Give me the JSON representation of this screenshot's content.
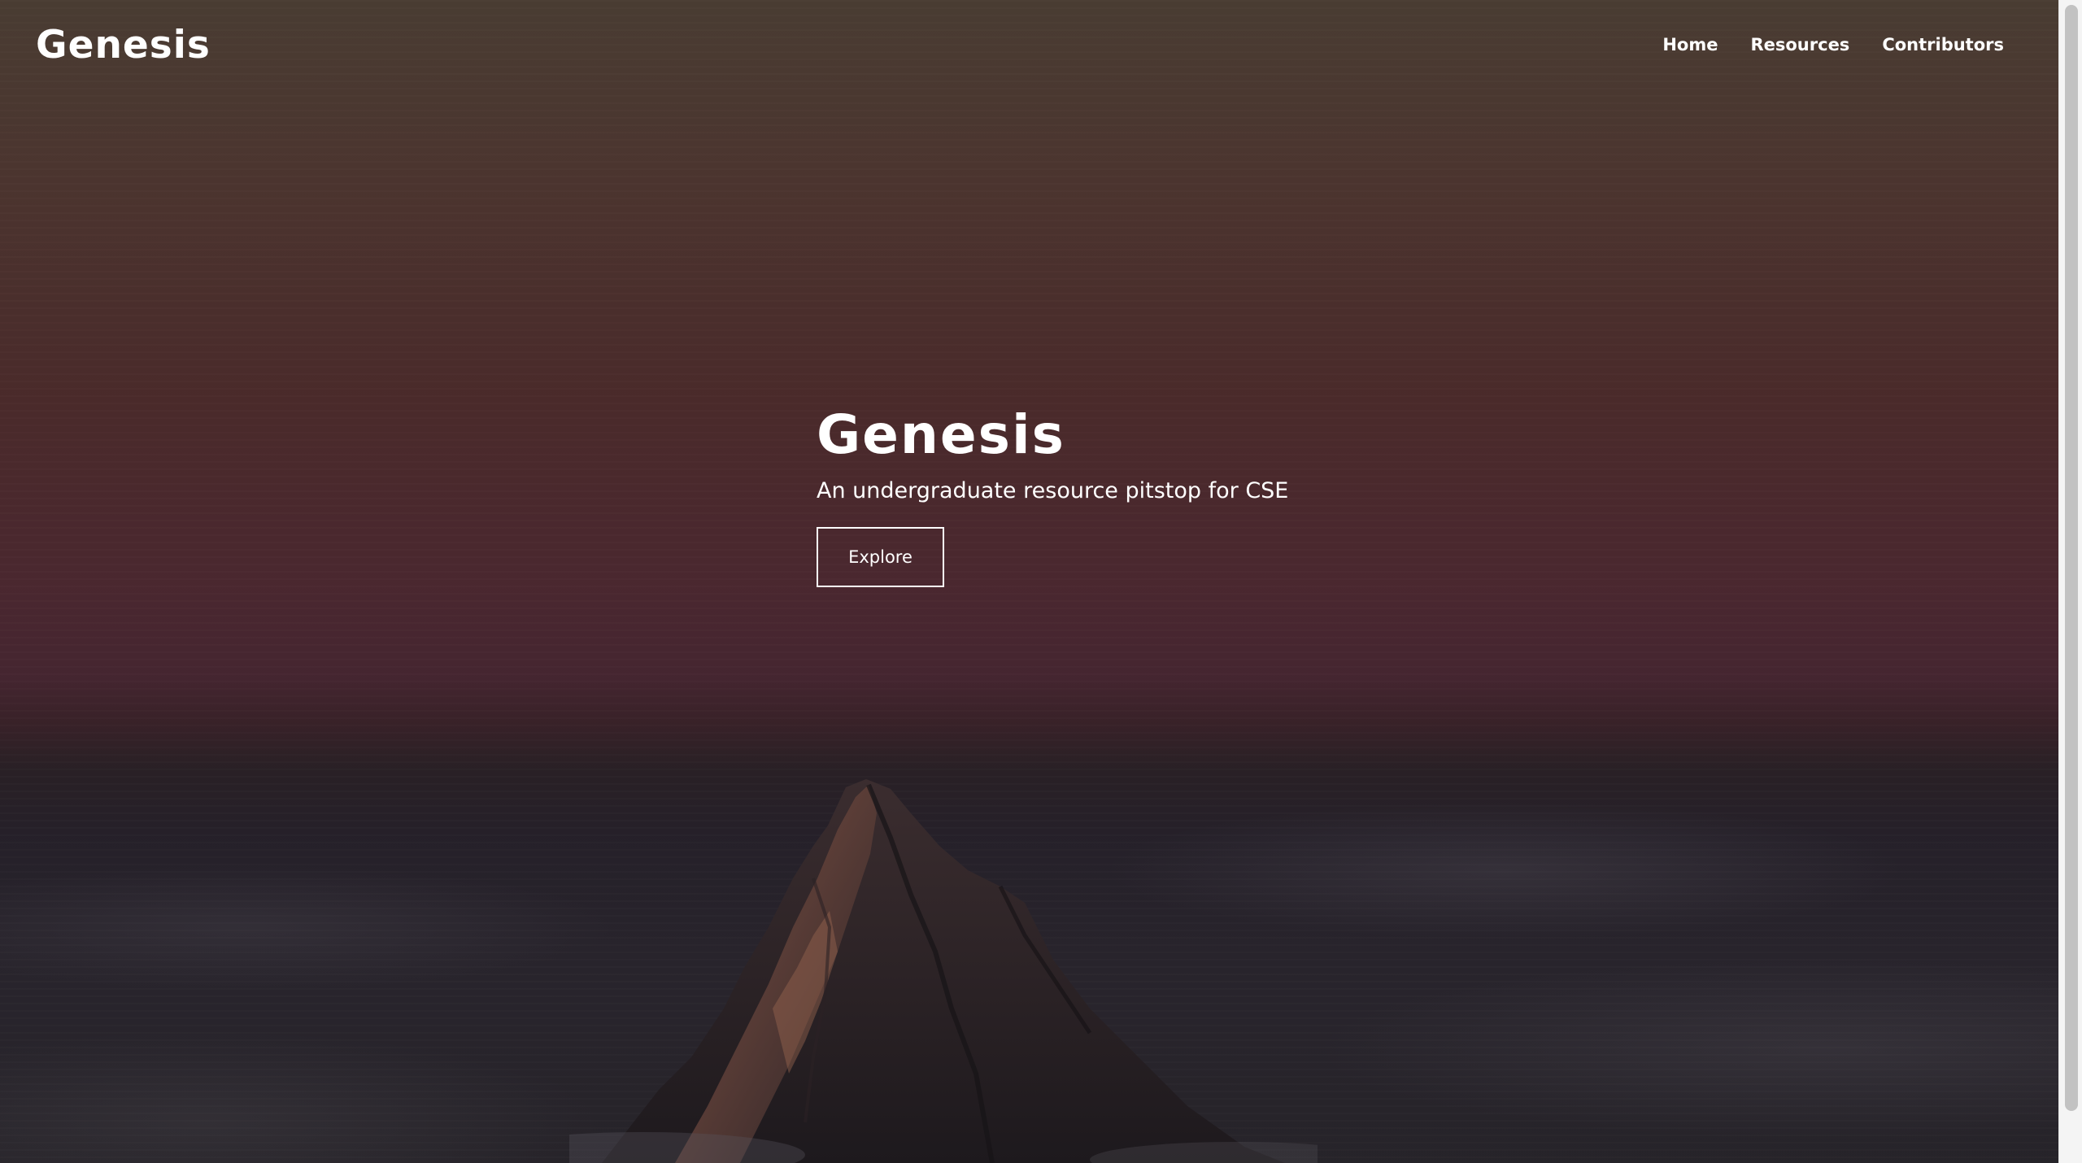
{
  "navbar": {
    "brand": "Genesis",
    "links": [
      {
        "label": "Home"
      },
      {
        "label": "Resources"
      },
      {
        "label": "Contributors"
      }
    ]
  },
  "hero": {
    "title": "Genesis",
    "subtitle": "An undergraduate resource pitstop for CSE",
    "button_label": "Explore",
    "background": "mountain-peak-at-dusk",
    "colors": {
      "sky_top": "#4a3d33",
      "sky_mid": "#4b2830",
      "clouds": "#27242a",
      "text": "#ffffff"
    }
  }
}
